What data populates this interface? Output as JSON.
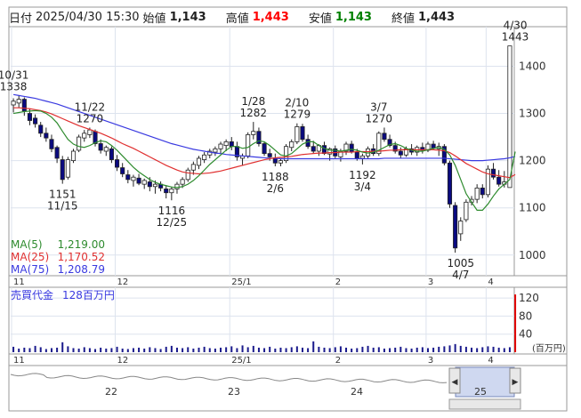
{
  "header": {
    "date_label": "日付",
    "datetime": "2025/04/30 15:30",
    "open_label": "始値",
    "open": "1,143",
    "high_label": "高値",
    "high": "1,443",
    "low_label": "安値",
    "low": "1,143",
    "close_label": "終値",
    "close": "1,443"
  },
  "colors": {
    "up": "#0a0a80",
    "down": "#ffffff",
    "high": "#ff0000",
    "low": "#008000",
    "ma5": "#2e8b2e",
    "ma25": "#e03030",
    "ma75": "#3a3ae0",
    "volume": "#1a1a8c",
    "volume_last": "#e00000"
  },
  "legend": [
    {
      "name": "MA(5)",
      "value": "1,219.00"
    },
    {
      "name": "MA(25)",
      "value": "1,170.52"
    },
    {
      "name": "MA(75)",
      "value": "1,208.79"
    }
  ],
  "volume_panel": {
    "label": "売買代金",
    "value": "128百万円",
    "unit": "(百万円)",
    "ticks": [
      "120",
      "80",
      "40"
    ]
  },
  "scroller": {
    "year_labels": [
      "22",
      "23",
      "24",
      "25"
    ],
    "left_arrow": "◀",
    "right_arrow": "▶"
  },
  "chart_data": {
    "type": "candlestick",
    "ylim": [
      960,
      1480
    ],
    "y_ticks": [
      "1400",
      "1300",
      "1200",
      "1100",
      "1000"
    ],
    "x_month_labels": [
      "11",
      "12",
      "25/1",
      "2",
      "3",
      "4"
    ],
    "annotations": [
      {
        "date": "10/31",
        "value": "1338",
        "kind": "high"
      },
      {
        "date": "11/22",
        "value": "1270",
        "kind": "high"
      },
      {
        "date": "11/15",
        "value": "1151",
        "kind": "low"
      },
      {
        "date": "12/25",
        "value": "1116",
        "kind": "low"
      },
      {
        "date": "1/28",
        "value": "1282",
        "kind": "high"
      },
      {
        "date": "2/10",
        "value": "1279",
        "kind": "high"
      },
      {
        "date": "2/6",
        "value": "1188",
        "kind": "low"
      },
      {
        "date": "3/7",
        "value": "1270",
        "kind": "high"
      },
      {
        "date": "3/4",
        "value": "1192",
        "kind": "low"
      },
      {
        "date": "4/7",
        "value": "1005",
        "kind": "low"
      },
      {
        "date": "4/30",
        "value": "1443",
        "kind": "high"
      }
    ],
    "candles": [
      [
        1318,
        1332,
        1302,
        1326
      ],
      [
        1322,
        1338,
        1312,
        1330
      ],
      [
        1330,
        1334,
        1295,
        1305
      ],
      [
        1300,
        1310,
        1275,
        1285
      ],
      [
        1290,
        1298,
        1270,
        1278
      ],
      [
        1275,
        1282,
        1250,
        1258
      ],
      [
        1258,
        1270,
        1240,
        1248
      ],
      [
        1245,
        1255,
        1218,
        1225
      ],
      [
        1228,
        1232,
        1195,
        1205
      ],
      [
        1202,
        1210,
        1151,
        1160
      ],
      [
        1165,
        1208,
        1160,
        1202
      ],
      [
        1200,
        1225,
        1195,
        1220
      ],
      [
        1222,
        1255,
        1218,
        1250
      ],
      [
        1248,
        1265,
        1240,
        1258
      ],
      [
        1255,
        1270,
        1248,
        1265
      ],
      [
        1262,
        1266,
        1230,
        1236
      ],
      [
        1236,
        1245,
        1215,
        1222
      ],
      [
        1220,
        1232,
        1210,
        1228
      ],
      [
        1225,
        1230,
        1195,
        1202
      ],
      [
        1202,
        1212,
        1178,
        1186
      ],
      [
        1185,
        1195,
        1165,
        1172
      ],
      [
        1170,
        1180,
        1152,
        1160
      ],
      [
        1158,
        1170,
        1145,
        1165
      ],
      [
        1163,
        1172,
        1148,
        1152
      ],
      [
        1150,
        1162,
        1140,
        1158
      ],
      [
        1155,
        1165,
        1135,
        1145
      ],
      [
        1145,
        1158,
        1130,
        1150
      ],
      [
        1150,
        1156,
        1135,
        1142
      ],
      [
        1140,
        1148,
        1120,
        1132
      ],
      [
        1132,
        1145,
        1116,
        1140
      ],
      [
        1140,
        1155,
        1130,
        1150
      ],
      [
        1150,
        1165,
        1142,
        1160
      ],
      [
        1160,
        1185,
        1155,
        1180
      ],
      [
        1180,
        1198,
        1170,
        1192
      ],
      [
        1190,
        1210,
        1182,
        1205
      ],
      [
        1202,
        1218,
        1195,
        1212
      ],
      [
        1212,
        1225,
        1205,
        1220
      ],
      [
        1218,
        1230,
        1210,
        1225
      ],
      [
        1225,
        1240,
        1215,
        1235
      ],
      [
        1232,
        1245,
        1220,
        1240
      ],
      [
        1240,
        1250,
        1222,
        1230
      ],
      [
        1230,
        1240,
        1200,
        1208
      ],
      [
        1205,
        1215,
        1190,
        1210
      ],
      [
        1210,
        1260,
        1205,
        1255
      ],
      [
        1255,
        1282,
        1245,
        1262
      ],
      [
        1262,
        1270,
        1230,
        1236
      ],
      [
        1236,
        1240,
        1210,
        1215
      ],
      [
        1215,
        1225,
        1200,
        1208
      ],
      [
        1206,
        1215,
        1188,
        1195
      ],
      [
        1195,
        1205,
        1188,
        1200
      ],
      [
        1200,
        1235,
        1195,
        1230
      ],
      [
        1228,
        1245,
        1220,
        1240
      ],
      [
        1240,
        1279,
        1235,
        1272
      ],
      [
        1272,
        1278,
        1240,
        1245
      ],
      [
        1245,
        1255,
        1225,
        1230
      ],
      [
        1230,
        1242,
        1215,
        1220
      ],
      [
        1220,
        1235,
        1210,
        1232
      ],
      [
        1232,
        1240,
        1212,
        1215
      ],
      [
        1214,
        1228,
        1200,
        1225
      ],
      [
        1225,
        1232,
        1205,
        1210
      ],
      [
        1208,
        1225,
        1198,
        1220
      ],
      [
        1220,
        1240,
        1212,
        1235
      ],
      [
        1235,
        1242,
        1215,
        1218
      ],
      [
        1218,
        1225,
        1200,
        1205
      ],
      [
        1205,
        1215,
        1192,
        1210
      ],
      [
        1210,
        1230,
        1205,
        1225
      ],
      [
        1225,
        1235,
        1210,
        1215
      ],
      [
        1215,
        1262,
        1210,
        1258
      ],
      [
        1258,
        1270,
        1240,
        1245
      ],
      [
        1245,
        1255,
        1228,
        1232
      ],
      [
        1232,
        1240,
        1215,
        1220
      ],
      [
        1220,
        1228,
        1205,
        1212
      ],
      [
        1212,
        1230,
        1208,
        1225
      ],
      [
        1225,
        1235,
        1212,
        1218
      ],
      [
        1218,
        1232,
        1210,
        1228
      ],
      [
        1228,
        1238,
        1215,
        1222
      ],
      [
        1222,
        1240,
        1218,
        1235
      ],
      [
        1235,
        1242,
        1222,
        1226
      ],
      [
        1225,
        1238,
        1210,
        1230
      ],
      [
        1230,
        1235,
        1190,
        1195
      ],
      [
        1195,
        1200,
        1100,
        1108
      ],
      [
        1105,
        1112,
        1005,
        1015
      ],
      [
        1045,
        1080,
        1030,
        1072
      ],
      [
        1075,
        1118,
        1070,
        1112
      ],
      [
        1112,
        1125,
        1105,
        1118
      ],
      [
        1118,
        1150,
        1110,
        1142
      ],
      [
        1142,
        1150,
        1120,
        1128
      ],
      [
        1128,
        1190,
        1122,
        1182
      ],
      [
        1182,
        1195,
        1160,
        1165
      ],
      [
        1165,
        1180,
        1145,
        1150
      ],
      [
        1150,
        1178,
        1143,
        1155
      ],
      [
        1143,
        1443,
        1143,
        1443
      ]
    ],
    "ma5": [
      1300,
      1302,
      1304,
      1305,
      1306,
      1305,
      1300,
      1292,
      1280,
      1262,
      1245,
      1235,
      1230,
      1228,
      1232,
      1238,
      1242,
      1240,
      1232,
      1222,
      1210,
      1198,
      1186,
      1176,
      1168,
      1160,
      1154,
      1150,
      1147,
      1144,
      1143,
      1145,
      1150,
      1158,
      1168,
      1180,
      1192,
      1202,
      1212,
      1222,
      1230,
      1230,
      1226,
      1228,
      1236,
      1242,
      1240,
      1232,
      1222,
      1212,
      1210,
      1215,
      1225,
      1235,
      1240,
      1240,
      1232,
      1226,
      1222,
      1222,
      1220,
      1222,
      1224,
      1222,
      1218,
      1216,
      1218,
      1222,
      1228,
      1234,
      1236,
      1232,
      1226,
      1222,
      1220,
      1220,
      1223,
      1226,
      1228,
      1224,
      1212,
      1190,
      1160,
      1130,
      1112,
      1095,
      1095,
      1108,
      1125,
      1140,
      1150,
      1160,
      1219
    ],
    "ma25": [
      1312,
      1312,
      1311,
      1310,
      1308,
      1306,
      1303,
      1299,
      1294,
      1289,
      1284,
      1279,
      1274,
      1270,
      1266,
      1262,
      1258,
      1253,
      1248,
      1242,
      1236,
      1231,
      1226,
      1220,
      1214,
      1208,
      1202,
      1196,
      1190,
      1185,
      1180,
      1176,
      1174,
      1173,
      1172,
      1173,
      1174,
      1176,
      1178,
      1181,
      1184,
      1187,
      1190,
      1193,
      1196,
      1199,
      1202,
      1204,
      1206,
      1207,
      1208,
      1209,
      1211,
      1213,
      1214,
      1215,
      1216,
      1216,
      1217,
      1217,
      1218,
      1218,
      1218,
      1219,
      1219,
      1219,
      1220,
      1220,
      1221,
      1222,
      1222,
      1223,
      1223,
      1223,
      1223,
      1223,
      1223,
      1223,
      1222,
      1221,
      1217,
      1210,
      1202,
      1194,
      1188,
      1182,
      1176,
      1172,
      1170,
      1168,
      1166,
      1164,
      1170.52
    ],
    "ma75": [
      1340,
      1338,
      1336,
      1334,
      1332,
      1329,
      1326,
      1323,
      1320,
      1316,
      1312,
      1308,
      1304,
      1300,
      1296,
      1292,
      1288,
      1284,
      1280,
      1276,
      1272,
      1268,
      1264,
      1260,
      1256,
      1252,
      1248,
      1244,
      1240,
      1236,
      1233,
      1230,
      1227,
      1224,
      1222,
      1220,
      1218,
      1216,
      1215,
      1213,
      1212,
      1211,
      1210,
      1209,
      1208,
      1207,
      1206,
      1205,
      1205,
      1204,
      1204,
      1204,
      1204,
      1204,
      1204,
      1204,
      1204,
      1204,
      1204,
      1204,
      1204,
      1204,
      1204,
      1204,
      1204,
      1204,
      1204,
      1204,
      1205,
      1205,
      1205,
      1205,
      1205,
      1205,
      1205,
      1205,
      1205,
      1205,
      1205,
      1205,
      1204,
      1203,
      1202,
      1201,
      1200,
      1200,
      1200,
      1201,
      1202,
      1203,
      1204,
      1206,
      1208.79
    ],
    "volume": [
      12,
      8,
      10,
      9,
      14,
      11,
      7,
      9,
      10,
      22,
      13,
      9,
      8,
      11,
      9,
      7,
      10,
      8,
      9,
      12,
      8,
      7,
      9,
      10,
      8,
      11,
      9,
      7,
      12,
      14,
      10,
      9,
      11,
      8,
      10,
      12,
      9,
      8,
      10,
      11,
      13,
      9,
      15,
      11,
      14,
      10,
      9,
      12,
      8,
      10,
      9,
      11,
      13,
      10,
      9,
      24,
      12,
      10,
      9,
      11,
      13,
      10,
      8,
      9,
      12,
      14,
      10,
      11,
      8,
      9,
      10,
      12,
      9,
      8,
      10,
      11,
      9,
      10,
      12,
      13,
      15,
      18,
      14,
      12,
      10,
      9,
      11,
      13,
      12,
      10,
      9,
      11,
      128
    ],
    "vol_ylim": [
      0,
      140
    ],
    "vol_ticks": [
      120,
      80,
      40
    ]
  }
}
